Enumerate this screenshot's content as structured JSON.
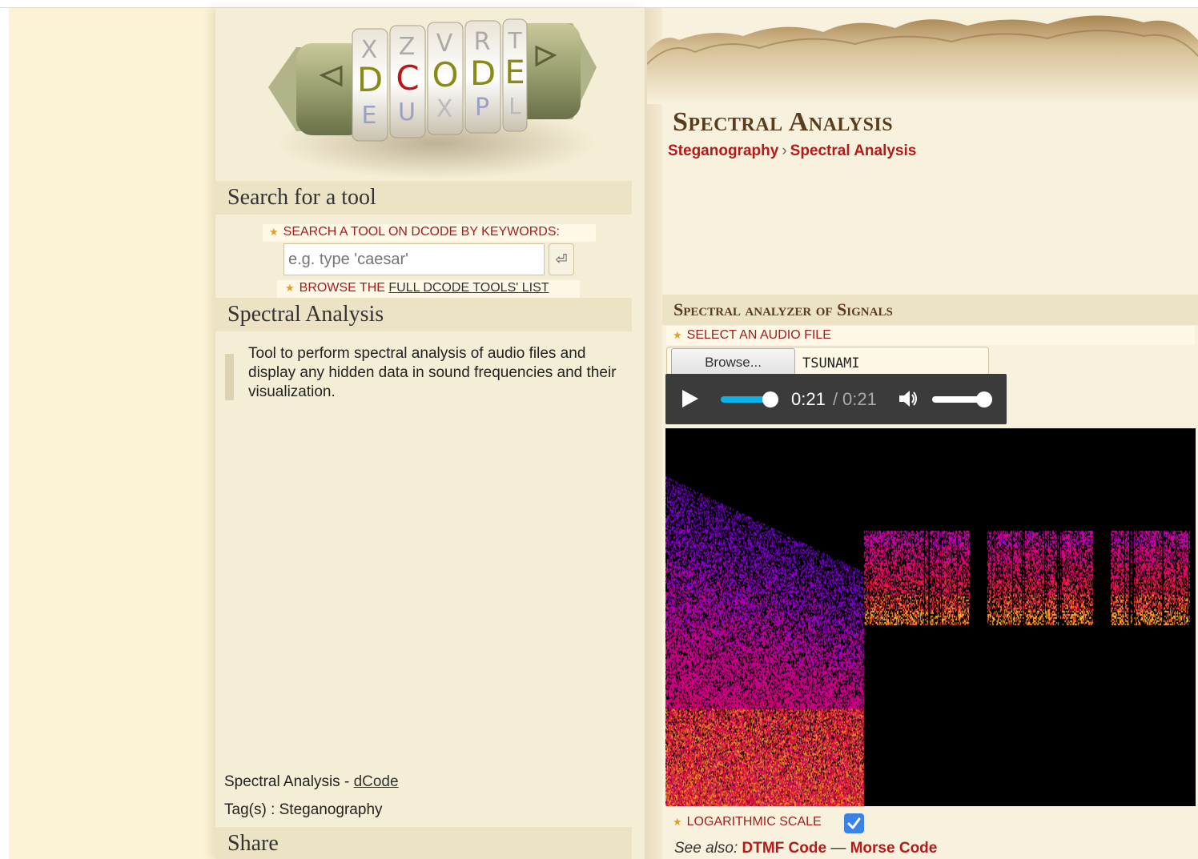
{
  "logo": {
    "letters_top": [
      "X",
      "Z",
      "V",
      "R",
      "T"
    ],
    "letters_mid": [
      "D",
      "C",
      "O",
      "D",
      "E"
    ],
    "letters_bot": [
      "E",
      "U",
      "X",
      "P",
      "L"
    ]
  },
  "search": {
    "heading": "Search for a tool",
    "label": "Search a tool on dCode by keywords:",
    "placeholder": "e.g. type 'caesar'",
    "go_glyph": "⏎",
    "browse_prefix": "BROWSE THE ",
    "browse_link": "FULL DCODE TOOLS' LIST"
  },
  "tool": {
    "heading": "Spectral Analysis",
    "description": "Tool to perform spectral analysis of audio files and display any hidden data in sound frequencies and their visualization.",
    "credit_prefix": "Spectral Analysis - ",
    "credit_link": "dCode",
    "tags": "Tag(s) : Steganography"
  },
  "share": {
    "heading": "Share"
  },
  "page": {
    "title": "Spectral Analysis",
    "breadcrumb": [
      {
        "label": "Steganography"
      },
      {
        "label": "Spectral Analysis"
      }
    ],
    "breadcrumb_sep": "›"
  },
  "analyzer": {
    "heading": "Spectral analyzer of Signals",
    "select_label": "Select an audio file",
    "browse_button": "Browse...",
    "file_name": "TSUNAMI",
    "time_current": "0:21",
    "time_sep": "/",
    "time_duration": "0:21",
    "progress": 1.0,
    "volume": 0.9,
    "log_label": "Logarithmic scale",
    "log_checked": true
  },
  "see_also": {
    "prefix": "See also: ",
    "links": [
      "DTMF Code",
      "Morse Code"
    ],
    "sep": " — "
  },
  "colors": {
    "accent_red": "#b41a1a",
    "title_brown": "#5a3c1c",
    "player_bg": "#3b3b3b",
    "seek": "#0bb3e8",
    "checkbox": "#3b82e6"
  },
  "icons": {
    "star": "star-icon",
    "enter": "enter-icon",
    "play": "play-icon",
    "volume": "volume-icon",
    "check": "check-icon"
  }
}
